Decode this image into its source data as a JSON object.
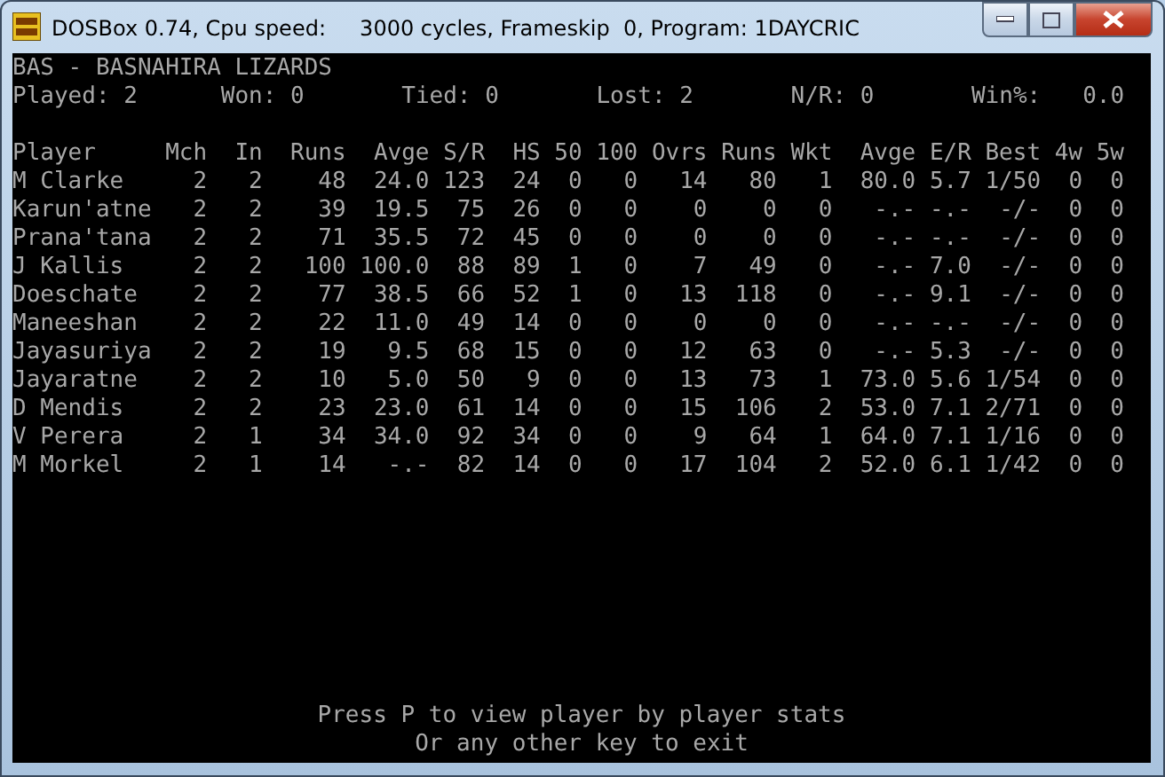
{
  "window": {
    "title": "DOSBox 0.74, Cpu speed:     3000 cycles, Frameskip  0, Program: 1DAYCRIC"
  },
  "team": {
    "title": "BAS - BASNAHIRA LIZARDS",
    "stats": [
      {
        "label": "Played:",
        "value": "2"
      },
      {
        "label": "Won:",
        "value": "0"
      },
      {
        "label": "Tied:",
        "value": "0"
      },
      {
        "label": "Lost:",
        "value": "2"
      },
      {
        "label": "N/R:",
        "value": "0"
      },
      {
        "label": "Win%:",
        "value": "0.0"
      }
    ]
  },
  "table": {
    "columns": [
      "Player",
      "Mch",
      "In",
      "Runs",
      "Avge",
      "S/R",
      "HS",
      "50",
      "100",
      "Ovrs",
      "Runs",
      "Wkt",
      "Avge",
      "E/R",
      "Best",
      "4w",
      "5w"
    ],
    "rows": [
      [
        "M Clarke",
        "2",
        "2",
        "48",
        "24.0",
        "123",
        "24",
        "0",
        "0",
        "14",
        "80",
        "1",
        "80.0",
        "5.7",
        "1/50",
        "0",
        "0"
      ],
      [
        "Karun'atne",
        "2",
        "2",
        "39",
        "19.5",
        "75",
        "26",
        "0",
        "0",
        "0",
        "0",
        "0",
        "-.-",
        "-.-",
        "-/-",
        "0",
        "0"
      ],
      [
        "Prana'tana",
        "2",
        "2",
        "71",
        "35.5",
        "72",
        "45",
        "0",
        "0",
        "0",
        "0",
        "0",
        "-.-",
        "-.-",
        "-/-",
        "0",
        "0"
      ],
      [
        "J Kallis",
        "2",
        "2",
        "100",
        "100.0",
        "88",
        "89",
        "1",
        "0",
        "7",
        "49",
        "0",
        "-.-",
        "7.0",
        "-/-",
        "0",
        "0"
      ],
      [
        "Doeschate",
        "2",
        "2",
        "77",
        "38.5",
        "66",
        "52",
        "1",
        "0",
        "13",
        "118",
        "0",
        "-.-",
        "9.1",
        "-/-",
        "0",
        "0"
      ],
      [
        "Maneeshan",
        "2",
        "2",
        "22",
        "11.0",
        "49",
        "14",
        "0",
        "0",
        "0",
        "0",
        "0",
        "-.-",
        "-.-",
        "-/-",
        "0",
        "0"
      ],
      [
        "Jayasuriya",
        "2",
        "2",
        "19",
        "9.5",
        "68",
        "15",
        "0",
        "0",
        "12",
        "63",
        "0",
        "-.-",
        "5.3",
        "-/-",
        "0",
        "0"
      ],
      [
        "Jayaratne",
        "2",
        "2",
        "10",
        "5.0",
        "50",
        "9",
        "0",
        "0",
        "13",
        "73",
        "1",
        "73.0",
        "5.6",
        "1/54",
        "0",
        "0"
      ],
      [
        "D Mendis",
        "2",
        "2",
        "23",
        "23.0",
        "61",
        "14",
        "0",
        "0",
        "15",
        "106",
        "2",
        "53.0",
        "7.1",
        "2/71",
        "0",
        "0"
      ],
      [
        "V Perera",
        "2",
        "1",
        "34",
        "34.0",
        "92",
        "34",
        "0",
        "0",
        "9",
        "64",
        "1",
        "64.0",
        "7.1",
        "1/16",
        "0",
        "0"
      ],
      [
        "M Morkel",
        "2",
        "1",
        "14",
        "-.-",
        "82",
        "14",
        "0",
        "0",
        "17",
        "104",
        "2",
        "52.0",
        "6.1",
        "1/42",
        "0",
        "0"
      ]
    ]
  },
  "footer": [
    "Press P to view player by player stats",
    "Or any other key to exit"
  ]
}
